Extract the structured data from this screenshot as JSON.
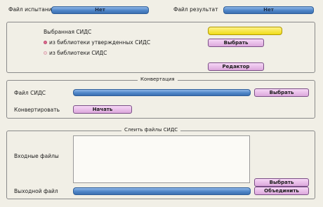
{
  "top": {
    "test_file_label": "Файл испытания",
    "test_file_value": "Нет",
    "result_file_label": "Файл результат",
    "result_file_value": "Нет"
  },
  "sids_section": {
    "selected_label": "Выбранная СИДС",
    "option_approved_label": "из библиотеки утвержденных СИДС",
    "option_library_label": "из библиотеки СИДС",
    "select_button": "Выбрать",
    "editor_button": "Редактор"
  },
  "conversion": {
    "title": "Конвертация",
    "file_label": "Файл СИДС",
    "select_button": "Выбрать",
    "convert_label": "Конвертировать",
    "start_button": "Начать"
  },
  "merge": {
    "title": "Слеить файлы СИДС",
    "input_files_label": "Входные файлы",
    "select_button": "Выбрать",
    "output_file_label": "Выходной файл",
    "merge_button": "Объединить"
  },
  "colors": {
    "accent_bar": "#4f86c8",
    "selected_field": "#f0dc16",
    "button": "#dca8dc",
    "radio_selected": "#e26b8f"
  }
}
